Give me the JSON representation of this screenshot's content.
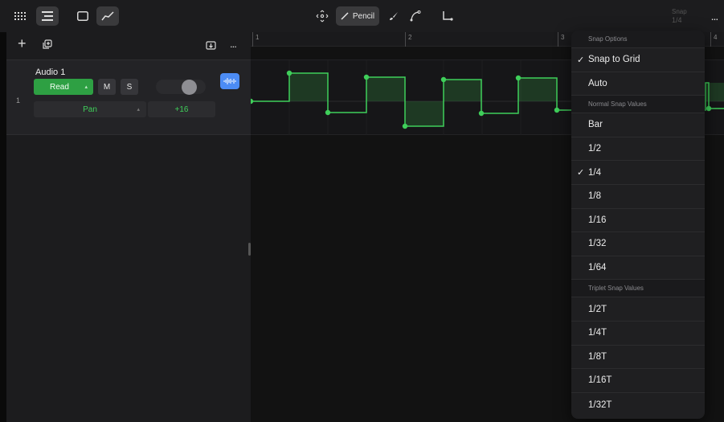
{
  "toolbar": {
    "pencil_label": "Pencil",
    "snap_label": "Snap",
    "snap_value": "1/4",
    "more": "..."
  },
  "tracklist": {
    "add": "+",
    "more": "..."
  },
  "track": {
    "number": "1",
    "name": "Audio 1",
    "read_label": "Read",
    "mute_label": "M",
    "solo_label": "S",
    "pan_label": "Pan",
    "pan_value": "+16"
  },
  "ruler": {
    "bars": [
      "1",
      "2",
      "3",
      "4"
    ]
  },
  "automation": {
    "color": "#3fcf5a",
    "segments": [
      "high",
      "low",
      "high",
      "low",
      "high",
      "low",
      "high"
    ]
  },
  "menu": {
    "sections": [
      {
        "header": "Snap Options",
        "items": [
          {
            "label": "Snap to Grid",
            "checked": true
          },
          {
            "label": "Auto",
            "checked": false
          }
        ]
      },
      {
        "header": "Normal Snap Values",
        "items": [
          {
            "label": "Bar",
            "checked": false
          },
          {
            "label": "1/2",
            "checked": false
          },
          {
            "label": "1/4",
            "checked": true
          },
          {
            "label": "1/8",
            "checked": false
          },
          {
            "label": "1/16",
            "checked": false
          },
          {
            "label": "1/32",
            "checked": false
          },
          {
            "label": "1/64",
            "checked": false
          }
        ]
      },
      {
        "header": "Triplet Snap Values",
        "items": [
          {
            "label": "1/2T",
            "checked": false
          },
          {
            "label": "1/4T",
            "checked": false
          },
          {
            "label": "1/8T",
            "checked": false
          },
          {
            "label": "1/16T",
            "checked": false
          },
          {
            "label": "1/32T",
            "checked": false
          }
        ]
      }
    ]
  }
}
